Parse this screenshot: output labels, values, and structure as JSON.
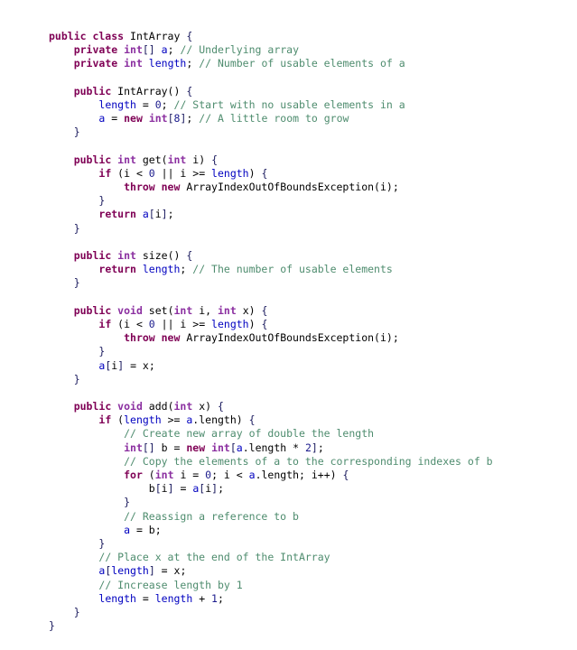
{
  "document": {
    "kind": "source-code-listing",
    "language": "Java",
    "class_name": "IntArray",
    "background_color": "#ffffff",
    "palette": {
      "keyword": "#7F0055",
      "type": "#8B2FA0",
      "field": "#0000C0",
      "number": "#1A1A8C",
      "comment": "#4E8C6E",
      "plain": "#000000",
      "brace": "#1A1A5E"
    }
  },
  "code": {
    "lines": [
      {
        "indent": 0,
        "tokens": [
          {
            "t": "kw",
            "v": "public class "
          },
          {
            "t": "pl",
            "v": "IntArray "
          },
          {
            "t": "br",
            "v": "{"
          }
        ]
      },
      {
        "indent": 1,
        "tokens": [
          {
            "t": "kw",
            "v": "private "
          },
          {
            "t": "typ",
            "v": "int"
          },
          {
            "t": "br",
            "v": "[]"
          },
          {
            "t": "pl",
            "v": " "
          },
          {
            "t": "fld",
            "v": "a"
          },
          {
            "t": "pl",
            "v": "; "
          },
          {
            "t": "cmt",
            "v": "// Underlying array"
          }
        ]
      },
      {
        "indent": 1,
        "tokens": [
          {
            "t": "kw",
            "v": "private "
          },
          {
            "t": "typ",
            "v": "int "
          },
          {
            "t": "fld",
            "v": "length"
          },
          {
            "t": "pl",
            "v": "; "
          },
          {
            "t": "cmt",
            "v": "// Number of usable elements of a"
          }
        ]
      },
      {
        "indent": 0,
        "tokens": []
      },
      {
        "indent": 1,
        "tokens": [
          {
            "t": "kw",
            "v": "public "
          },
          {
            "t": "pl",
            "v": "IntArray() "
          },
          {
            "t": "br",
            "v": "{"
          }
        ]
      },
      {
        "indent": 2,
        "tokens": [
          {
            "t": "fld",
            "v": "length"
          },
          {
            "t": "pl",
            "v": " = "
          },
          {
            "t": "num",
            "v": "0"
          },
          {
            "t": "pl",
            "v": "; "
          },
          {
            "t": "cmt",
            "v": "// Start with no usable elements in a"
          }
        ]
      },
      {
        "indent": 2,
        "tokens": [
          {
            "t": "fld",
            "v": "a"
          },
          {
            "t": "pl",
            "v": " = "
          },
          {
            "t": "kw",
            "v": "new "
          },
          {
            "t": "typ",
            "v": "int"
          },
          {
            "t": "br",
            "v": "["
          },
          {
            "t": "num",
            "v": "8"
          },
          {
            "t": "br",
            "v": "]"
          },
          {
            "t": "pl",
            "v": "; "
          },
          {
            "t": "cmt",
            "v": "// A little room to grow"
          }
        ]
      },
      {
        "indent": 1,
        "tokens": [
          {
            "t": "br",
            "v": "}"
          }
        ]
      },
      {
        "indent": 0,
        "tokens": []
      },
      {
        "indent": 1,
        "tokens": [
          {
            "t": "kw",
            "v": "public "
          },
          {
            "t": "typ",
            "v": "int "
          },
          {
            "t": "pl",
            "v": "get("
          },
          {
            "t": "typ",
            "v": "int "
          },
          {
            "t": "pl",
            "v": "i) "
          },
          {
            "t": "br",
            "v": "{"
          }
        ]
      },
      {
        "indent": 2,
        "tokens": [
          {
            "t": "kw",
            "v": "if "
          },
          {
            "t": "pl",
            "v": "(i < "
          },
          {
            "t": "num",
            "v": "0"
          },
          {
            "t": "pl",
            "v": " || i >= "
          },
          {
            "t": "fld",
            "v": "length"
          },
          {
            "t": "pl",
            "v": ") "
          },
          {
            "t": "br",
            "v": "{"
          }
        ]
      },
      {
        "indent": 3,
        "tokens": [
          {
            "t": "kw",
            "v": "throw new "
          },
          {
            "t": "pl",
            "v": "ArrayIndexOutOfBoundsException(i);"
          }
        ]
      },
      {
        "indent": 2,
        "tokens": [
          {
            "t": "br",
            "v": "}"
          }
        ]
      },
      {
        "indent": 2,
        "tokens": [
          {
            "t": "kw",
            "v": "return "
          },
          {
            "t": "fld",
            "v": "a"
          },
          {
            "t": "br",
            "v": "["
          },
          {
            "t": "pl",
            "v": "i"
          },
          {
            "t": "br",
            "v": "]"
          },
          {
            "t": "pl",
            "v": ";"
          }
        ]
      },
      {
        "indent": 1,
        "tokens": [
          {
            "t": "br",
            "v": "}"
          }
        ]
      },
      {
        "indent": 0,
        "tokens": []
      },
      {
        "indent": 1,
        "tokens": [
          {
            "t": "kw",
            "v": "public "
          },
          {
            "t": "typ",
            "v": "int "
          },
          {
            "t": "pl",
            "v": "size() "
          },
          {
            "t": "br",
            "v": "{"
          }
        ]
      },
      {
        "indent": 2,
        "tokens": [
          {
            "t": "kw",
            "v": "return "
          },
          {
            "t": "fld",
            "v": "length"
          },
          {
            "t": "pl",
            "v": "; "
          },
          {
            "t": "cmt",
            "v": "// The number of usable elements"
          }
        ]
      },
      {
        "indent": 1,
        "tokens": [
          {
            "t": "br",
            "v": "}"
          }
        ]
      },
      {
        "indent": 0,
        "tokens": []
      },
      {
        "indent": 1,
        "tokens": [
          {
            "t": "kw",
            "v": "public "
          },
          {
            "t": "typ",
            "v": "void "
          },
          {
            "t": "pl",
            "v": "set("
          },
          {
            "t": "typ",
            "v": "int "
          },
          {
            "t": "pl",
            "v": "i, "
          },
          {
            "t": "typ",
            "v": "int "
          },
          {
            "t": "pl",
            "v": "x) "
          },
          {
            "t": "br",
            "v": "{"
          }
        ]
      },
      {
        "indent": 2,
        "tokens": [
          {
            "t": "kw",
            "v": "if "
          },
          {
            "t": "pl",
            "v": "(i < "
          },
          {
            "t": "num",
            "v": "0"
          },
          {
            "t": "pl",
            "v": " || i >= "
          },
          {
            "t": "fld",
            "v": "length"
          },
          {
            "t": "pl",
            "v": ") "
          },
          {
            "t": "br",
            "v": "{"
          }
        ]
      },
      {
        "indent": 3,
        "tokens": [
          {
            "t": "kw",
            "v": "throw new "
          },
          {
            "t": "pl",
            "v": "ArrayIndexOutOfBoundsException(i);"
          }
        ]
      },
      {
        "indent": 2,
        "tokens": [
          {
            "t": "br",
            "v": "}"
          }
        ]
      },
      {
        "indent": 2,
        "tokens": [
          {
            "t": "fld",
            "v": "a"
          },
          {
            "t": "br",
            "v": "["
          },
          {
            "t": "pl",
            "v": "i"
          },
          {
            "t": "br",
            "v": "]"
          },
          {
            "t": "pl",
            "v": " = x;"
          }
        ]
      },
      {
        "indent": 1,
        "tokens": [
          {
            "t": "br",
            "v": "}"
          }
        ]
      },
      {
        "indent": 0,
        "tokens": []
      },
      {
        "indent": 1,
        "tokens": [
          {
            "t": "kw",
            "v": "public "
          },
          {
            "t": "typ",
            "v": "void "
          },
          {
            "t": "pl",
            "v": "add("
          },
          {
            "t": "typ",
            "v": "int "
          },
          {
            "t": "pl",
            "v": "x) "
          },
          {
            "t": "br",
            "v": "{"
          }
        ]
      },
      {
        "indent": 2,
        "tokens": [
          {
            "t": "kw",
            "v": "if "
          },
          {
            "t": "pl",
            "v": "("
          },
          {
            "t": "fld",
            "v": "length"
          },
          {
            "t": "pl",
            "v": " >= "
          },
          {
            "t": "fld",
            "v": "a"
          },
          {
            "t": "pl",
            "v": ".length) "
          },
          {
            "t": "br",
            "v": "{"
          }
        ]
      },
      {
        "indent": 3,
        "tokens": [
          {
            "t": "cmt",
            "v": "// Create new array of double the length"
          }
        ]
      },
      {
        "indent": 3,
        "tokens": [
          {
            "t": "typ",
            "v": "int"
          },
          {
            "t": "br",
            "v": "[]"
          },
          {
            "t": "pl",
            "v": " b = "
          },
          {
            "t": "kw",
            "v": "new "
          },
          {
            "t": "typ",
            "v": "int"
          },
          {
            "t": "br",
            "v": "["
          },
          {
            "t": "fld",
            "v": "a"
          },
          {
            "t": "pl",
            "v": ".length * "
          },
          {
            "t": "num",
            "v": "2"
          },
          {
            "t": "br",
            "v": "]"
          },
          {
            "t": "pl",
            "v": ";"
          }
        ]
      },
      {
        "indent": 3,
        "tokens": [
          {
            "t": "cmt",
            "v": "// Copy the elements of a to the corresponding indexes of b"
          }
        ]
      },
      {
        "indent": 3,
        "tokens": [
          {
            "t": "kw",
            "v": "for "
          },
          {
            "t": "pl",
            "v": "("
          },
          {
            "t": "typ",
            "v": "int "
          },
          {
            "t": "pl",
            "v": "i = "
          },
          {
            "t": "num",
            "v": "0"
          },
          {
            "t": "pl",
            "v": "; i < "
          },
          {
            "t": "fld",
            "v": "a"
          },
          {
            "t": "pl",
            "v": ".length; i++) "
          },
          {
            "t": "br",
            "v": "{"
          }
        ]
      },
      {
        "indent": 4,
        "tokens": [
          {
            "t": "pl",
            "v": "b"
          },
          {
            "t": "br",
            "v": "["
          },
          {
            "t": "pl",
            "v": "i"
          },
          {
            "t": "br",
            "v": "]"
          },
          {
            "t": "pl",
            "v": " = "
          },
          {
            "t": "fld",
            "v": "a"
          },
          {
            "t": "br",
            "v": "["
          },
          {
            "t": "pl",
            "v": "i"
          },
          {
            "t": "br",
            "v": "]"
          },
          {
            "t": "pl",
            "v": ";"
          }
        ]
      },
      {
        "indent": 3,
        "tokens": [
          {
            "t": "br",
            "v": "}"
          }
        ]
      },
      {
        "indent": 3,
        "tokens": [
          {
            "t": "cmt",
            "v": "// Reassign a reference to b"
          }
        ]
      },
      {
        "indent": 3,
        "tokens": [
          {
            "t": "fld",
            "v": "a"
          },
          {
            "t": "pl",
            "v": " = b;"
          }
        ]
      },
      {
        "indent": 2,
        "tokens": [
          {
            "t": "br",
            "v": "}"
          }
        ]
      },
      {
        "indent": 2,
        "tokens": [
          {
            "t": "cmt",
            "v": "// Place x at the end of the IntArray"
          }
        ]
      },
      {
        "indent": 2,
        "tokens": [
          {
            "t": "fld",
            "v": "a"
          },
          {
            "t": "br",
            "v": "["
          },
          {
            "t": "fld",
            "v": "length"
          },
          {
            "t": "br",
            "v": "]"
          },
          {
            "t": "pl",
            "v": " = x;"
          }
        ]
      },
      {
        "indent": 2,
        "tokens": [
          {
            "t": "cmt",
            "v": "// Increase length by 1"
          }
        ]
      },
      {
        "indent": 2,
        "tokens": [
          {
            "t": "fld",
            "v": "length"
          },
          {
            "t": "pl",
            "v": " = "
          },
          {
            "t": "fld",
            "v": "length"
          },
          {
            "t": "pl",
            "v": " + "
          },
          {
            "t": "num",
            "v": "1"
          },
          {
            "t": "pl",
            "v": ";"
          }
        ]
      },
      {
        "indent": 1,
        "tokens": [
          {
            "t": "br",
            "v": "}"
          }
        ]
      },
      {
        "indent": 0,
        "tokens": [
          {
            "t": "br",
            "v": "}"
          }
        ]
      }
    ]
  }
}
